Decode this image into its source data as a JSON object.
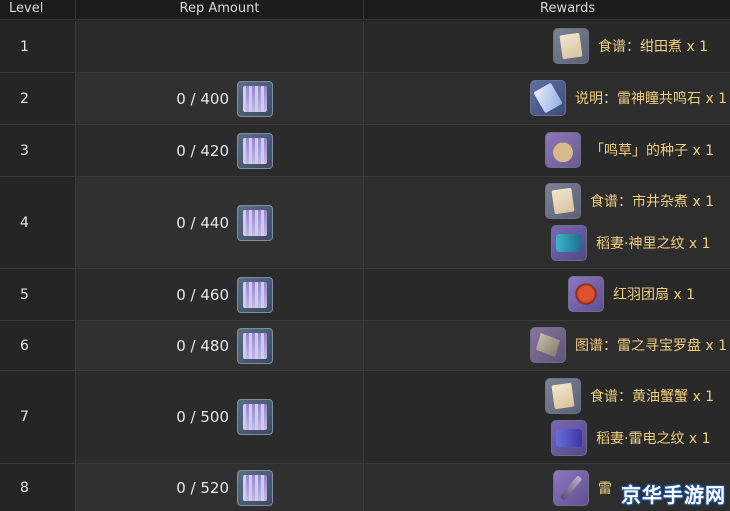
{
  "header": {
    "level": "Level",
    "rep_amount": "Rep Amount",
    "rewards": "Rewards"
  },
  "rows": [
    {
      "level": "1",
      "rep": "",
      "rewards": [
        {
          "icon": "recipe-icon",
          "text": "食谱：绀田煮 x 1"
        }
      ]
    },
    {
      "level": "2",
      "rep": "0 / 400",
      "rewards": [
        {
          "icon": "manual-icon",
          "text": "说明：雷神瞳共鸣石 x 1"
        }
      ]
    },
    {
      "level": "3",
      "rep": "0 / 420",
      "rewards": [
        {
          "icon": "seed-bag-icon",
          "text": "「鸣草」的种子 x 1"
        }
      ]
    },
    {
      "level": "4",
      "rep": "0 / 440",
      "rewards": [
        {
          "icon": "recipe-icon",
          "text": "食谱：市井杂煮 x 1"
        },
        {
          "icon": "namecard-icon",
          "text": "稻妻·神里之纹 x 1"
        }
      ]
    },
    {
      "level": "5",
      "rep": "0 / 460",
      "rewards": [
        {
          "icon": "red-feather-fan-icon",
          "text": "红羽团扇 x 1"
        }
      ]
    },
    {
      "level": "6",
      "rep": "0 / 480",
      "rewards": [
        {
          "icon": "treasure-compass-icon",
          "text": "图谱：雷之寻宝罗盘 x 1"
        }
      ]
    },
    {
      "level": "7",
      "rep": "0 / 500",
      "rewards": [
        {
          "icon": "recipe-icon",
          "text": "食谱：黄油蟹蟹 x 1"
        },
        {
          "icon": "namecard-icon",
          "text": "稻妻·雷电之纹 x 1"
        }
      ]
    },
    {
      "level": "8",
      "rep": "0 / 520",
      "rewards": [
        {
          "icon": "sword-icon",
          "text": "雷"
        }
      ]
    }
  ],
  "watermark": "京华手游网"
}
